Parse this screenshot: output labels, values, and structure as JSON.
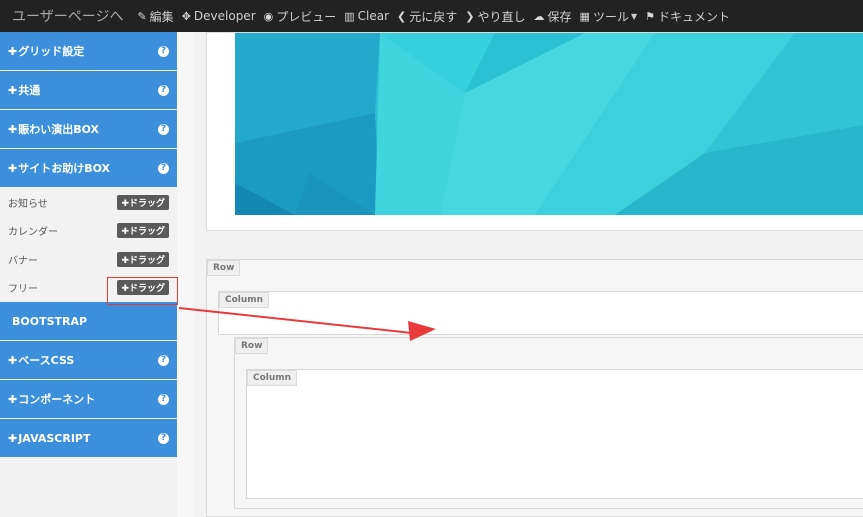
{
  "topbar": {
    "brand": "ユーザーページへ",
    "items": [
      {
        "icon": "edit-icon",
        "label": "編集"
      },
      {
        "icon": "code-icon",
        "label": "Developer"
      },
      {
        "icon": "eye-icon",
        "label": "プレビュー"
      },
      {
        "icon": "trash-icon",
        "label": "Clear"
      },
      {
        "icon": "undo-icon",
        "label": "元に戻す"
      },
      {
        "icon": "redo-icon",
        "label": "やり直し"
      },
      {
        "icon": "cloud-save-icon",
        "label": "保存"
      },
      {
        "icon": "grid-icon",
        "label": "ツール"
      },
      {
        "icon": "flag-icon",
        "label": "ドキュメント"
      }
    ]
  },
  "sidebar": {
    "sections_top": [
      {
        "label": "グリッド設定"
      },
      {
        "label": "共通"
      },
      {
        "label": "賑わい演出BOX"
      },
      {
        "label": "サイトお助けBOX"
      }
    ],
    "items": [
      {
        "label": "お知らせ",
        "tag": "ドラッグ"
      },
      {
        "label": "カレンダー",
        "tag": "ドラッグ"
      },
      {
        "label": "バナー",
        "tag": "ドラッグ"
      },
      {
        "label": "フリー",
        "tag": "ドラッグ"
      }
    ],
    "bootstrap": "BOOTSTRAP",
    "sections_bottom": [
      {
        "label": "ベースCSS"
      },
      {
        "label": "コンポーネント"
      },
      {
        "label": "JAVASCRIPT"
      }
    ]
  },
  "canvas": {
    "row1": "Row",
    "column1": "Column",
    "row2": "Row",
    "column2": "Column"
  },
  "colors": {
    "accent": "#3b8fdb",
    "topbar": "#222222",
    "arrow": "#e83a3a"
  }
}
